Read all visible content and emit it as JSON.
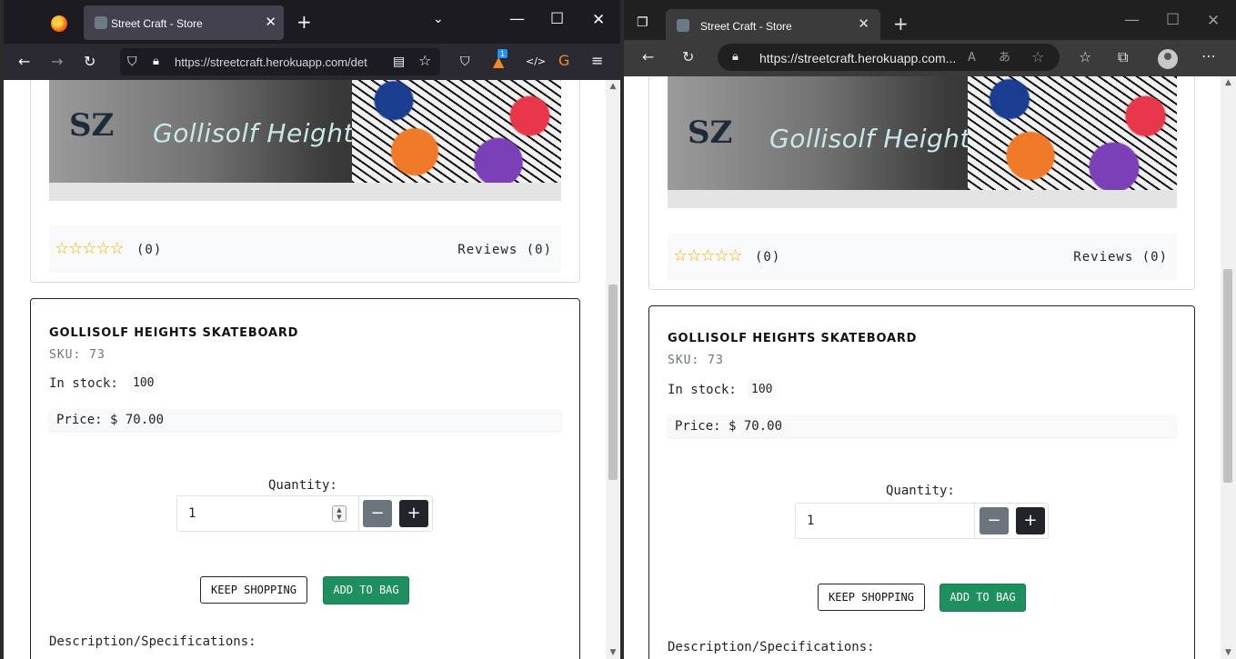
{
  "browser_left": {
    "tab_title": "Street Craft - Store",
    "url": "https://streetcraft.herokuapp.com/det",
    "extension_badge": "1"
  },
  "browser_right": {
    "tab_title": "Street Craft - Store",
    "url": "https://streetcraft.herokuapp.com..."
  },
  "product": {
    "banner_title": "Gollisolf Heights",
    "rating_count": "(0)",
    "reviews_label": "Reviews (0)",
    "name": "GOLLISOLF HEIGHTS SKATEBOARD",
    "sku": "SKU: 73",
    "stock_label": "In stock:",
    "stock_value": "100",
    "price": "Price: $ 70.00",
    "quantity_label": "Quantity:",
    "quantity_value": "1",
    "keep_shopping_label": "KEEP SHOPPING",
    "add_to_bag_label": "ADD TO BAG",
    "description_label": "Description/Specifications:",
    "stars": "☆☆☆☆☆",
    "rating_stars": 0
  },
  "colors": {
    "add_to_bag": "#1e8f5e",
    "star": "#f5b300",
    "plus_button": "#212529",
    "minus_button": "#6c757d"
  },
  "icons": {
    "firefox": [
      "firefox-logo-icon",
      "close-tab-icon",
      "new-tab-icon",
      "tab-list-icon",
      "minimize-icon",
      "maximize-icon",
      "close-window-icon",
      "back-icon",
      "forward-icon",
      "reload-icon",
      "shield-icon",
      "lock-icon",
      "reader-view-icon",
      "bookmark-star-icon",
      "pocket-icon",
      "extension-fox-icon",
      "extension-code-icon",
      "extension-g-icon",
      "menu-icon"
    ],
    "edge": [
      "tab-actions-icon",
      "close-tab-icon",
      "new-tab-icon",
      "minimize-icon",
      "maximize-icon",
      "close-window-icon",
      "back-icon",
      "reload-icon",
      "lock-icon",
      "read-aloud-icon",
      "translate-icon",
      "add-favorite-icon",
      "favorites-icon",
      "collections-icon",
      "profile-avatar",
      "more-icon"
    ]
  }
}
